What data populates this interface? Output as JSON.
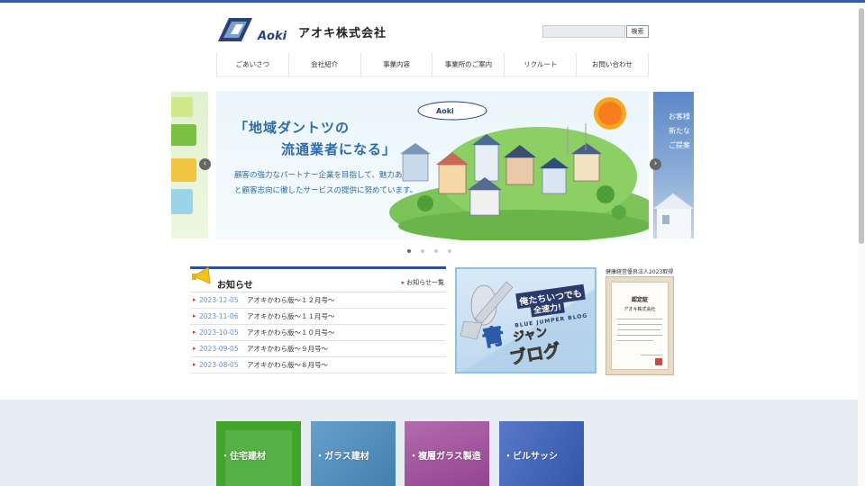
{
  "header": {
    "logo_text": "Aoki",
    "company_name": "アオキ株式会社",
    "search": {
      "value": "",
      "button_label": "検索"
    }
  },
  "nav": [
    "ごあいさつ",
    "会社紹介",
    "事業内容",
    "事業所のご案内",
    "リクルート",
    "お問い合わせ"
  ],
  "hero": {
    "title_line1": "「地域ダントツの",
    "title_line2": "流通業者になる」",
    "body": "顧客の強力なパートナー企業を目指して、魅力ある商品と顧客志向に徹したサービスの提供に努めています。",
    "prev_label": "‹",
    "next_label": "›",
    "active_slide": 1,
    "slide_count": 4
  },
  "side_slides": {
    "right_line1": "お客様",
    "right_line2": "新たな",
    "right_line3": "ご提案"
  },
  "news": {
    "title": "お知らせ",
    "more_label": "お知らせ一覧",
    "items": [
      {
        "date": "2023-12-05",
        "text": "アオキかわら版〜１２月号〜"
      },
      {
        "date": "2023-11-06",
        "text": "アオキかわら版〜１１月号〜"
      },
      {
        "date": "2023-10-05",
        "text": "アオキかわら版〜１０月号〜"
      },
      {
        "date": "2023-09-05",
        "text": "アオキかわら版〜９月号〜"
      },
      {
        "date": "2023-08-05",
        "text": "アオキかわら版〜８月号〜"
      }
    ]
  },
  "blog_banner": {
    "line1": "俺たちいつでも",
    "line2": "全速力!",
    "line3": "BLUE JUMPER BLOG",
    "big1": "青",
    "big2": "ジャン",
    "big3": "ブログ"
  },
  "certificate": {
    "label": "健康経営優良法人2023取得",
    "title": "認定証",
    "company": "アオキ株式会社"
  },
  "categories": [
    {
      "label": "・住宅建材",
      "color": "#3fa62a"
    },
    {
      "label": "・ガラス建材",
      "color": "#4b8fc2"
    },
    {
      "label": "・複層ガラス製造",
      "color": "#a24a9c"
    },
    {
      "label": "・ビルサッシ",
      "color": "#3b62c0"
    }
  ]
}
